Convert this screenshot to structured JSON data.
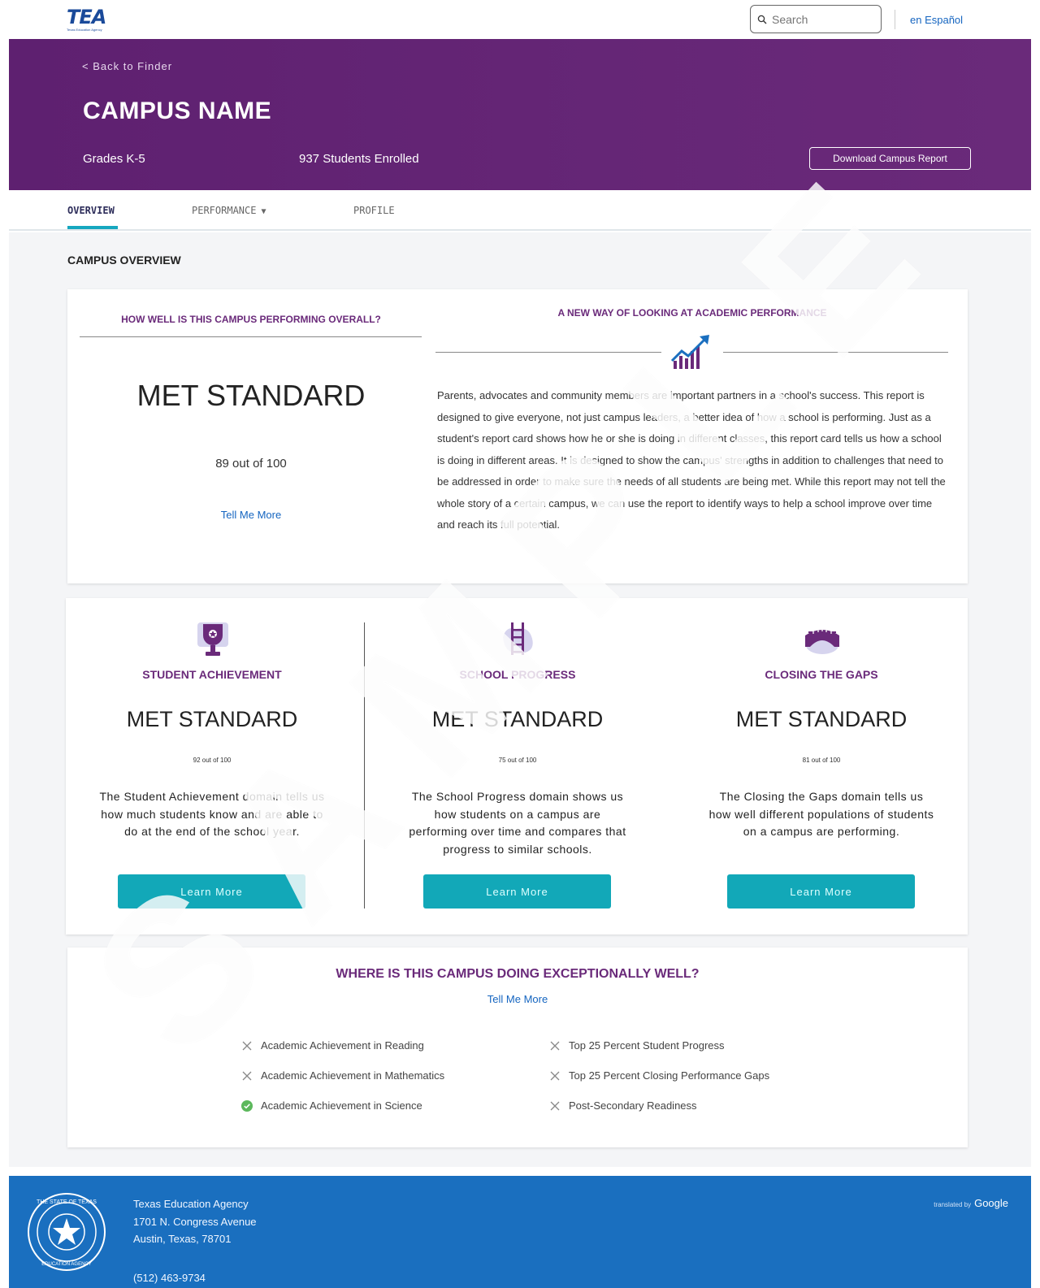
{
  "header": {
    "logo_text": "TEA",
    "logo_subtext": "Texas Education Agency",
    "search_placeholder": "Search",
    "language_link": "en Español"
  },
  "hero": {
    "back_link": "< Back to Finder",
    "campus_name": "CAMPUS NAME",
    "grades": "Grades K-5",
    "enrolled": "937 Students Enrolled",
    "download_button": "Download Campus Report"
  },
  "tabs": [
    {
      "label": "OVERVIEW",
      "active": true
    },
    {
      "label": "PERFORMANCE",
      "active": false
    },
    {
      "label": "PROFILE",
      "active": false
    }
  ],
  "overview": {
    "section_title": "CAMPUS OVERVIEW",
    "question": "HOW WELL IS THIS CAMPUS PERFORMING OVERALL?",
    "rating": "MET STANDARD",
    "score": "89 out of 100",
    "tell_more": "Tell Me More",
    "new_way_title": "A NEW WAY OF LOOKING AT ACADEMIC PERFORMANCE",
    "paragraph": "Parents, advocates and community members are important partners in a school's success. This report is designed to give everyone, not just campus leaders, a better idea of how a school is performing. Just as a student's report card shows how he or she is doing in different classes, this report card tells us how a school is doing in different areas. It is designed to show the campus' strengths in addition to challenges that need to be addressed in order to make sure the needs of all students are being met. While this report may not tell the whole story of a certain campus, we can use the report to identify ways to help a school improve over time and reach its full potential."
  },
  "domains": [
    {
      "icon": "trophy-icon",
      "title": "STUDENT ACHIEVEMENT",
      "rating": "MET STANDARD",
      "score": "92 out of 100",
      "description": "The Student Achievement domain tells us how much students know and are able to do at the end of the school year.",
      "button": "Learn More"
    },
    {
      "icon": "ladder-icon",
      "title": "SCHOOL PROGRESS",
      "rating": "MET STANDARD",
      "score": "75 out of 100",
      "description": "The School Progress domain shows us how students on a campus are performing over time and compares that progress to similar schools.",
      "button": "Learn More"
    },
    {
      "icon": "bridge-icon",
      "title": "CLOSING THE GAPS",
      "rating": "MET STANDARD",
      "score": "81 out of 100",
      "description": "The Closing the Gaps domain tells us how well different populations of students on a campus are performing.",
      "button": "Learn More"
    }
  ],
  "distinctions": {
    "title": "WHERE IS THIS CAMPUS DOING EXCEPTIONALLY WELL?",
    "tell_more": "Tell Me More",
    "left": [
      {
        "label": "Academic Achievement in Reading",
        "earned": false
      },
      {
        "label": "Academic Achievement in Mathematics",
        "earned": false
      },
      {
        "label": "Academic Achievement in Science",
        "earned": true
      }
    ],
    "right": [
      {
        "label": "Top 25 Percent Student Progress",
        "earned": false
      },
      {
        "label": "Top 25 Percent Closing Performance Gaps",
        "earned": false
      },
      {
        "label": "Post-Secondary Readiness",
        "earned": false
      }
    ]
  },
  "watermark": "SAMPLE",
  "footer": {
    "org": "Texas Education Agency",
    "address1": "1701 N. Congress Avenue",
    "address2": "Austin, Texas, 78701",
    "phone": "(512) 463-9734",
    "translated_by": "translated by",
    "google": "Google"
  },
  "colors": {
    "purple": "#6a2a7a",
    "teal": "#12a8b8",
    "link_blue": "#1565c0",
    "footer_blue": "#1a6fbf",
    "success_green": "#5cb85c"
  }
}
